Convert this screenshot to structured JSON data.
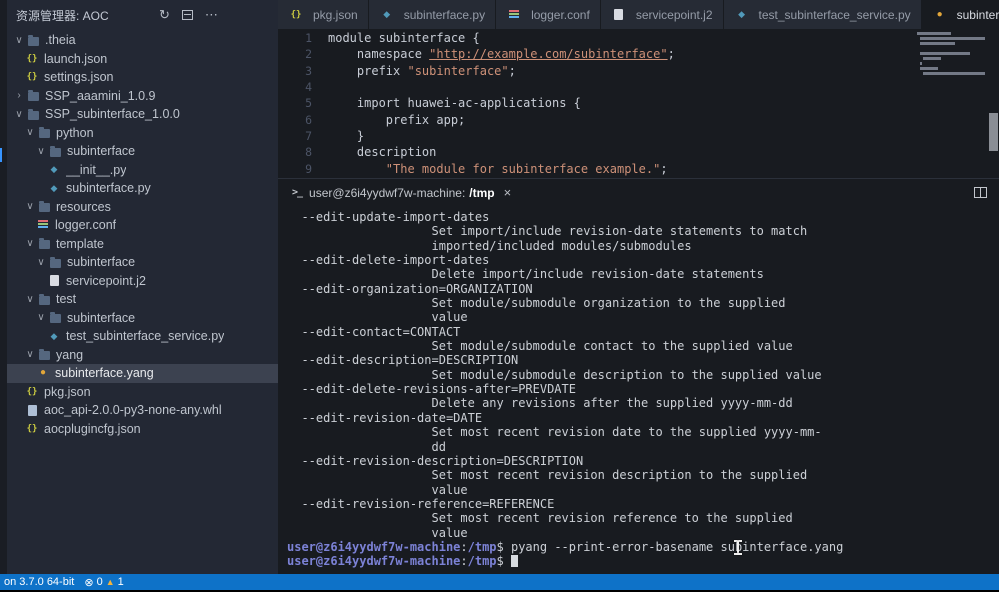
{
  "sidebar": {
    "title": "资源管理器: AOC",
    "items": [
      {
        "label": ".theia",
        "kind": "folder",
        "state": "open",
        "level": 0
      },
      {
        "label": "launch.json",
        "kind": "json",
        "level": 1
      },
      {
        "label": "settings.json",
        "kind": "json",
        "level": 1
      },
      {
        "label": "SSP_aaamini_1.0.9",
        "kind": "folder",
        "state": "closed",
        "level": 0
      },
      {
        "label": "SSP_subinterface_1.0.0",
        "kind": "folder",
        "state": "open",
        "level": 0
      },
      {
        "label": "python",
        "kind": "folder",
        "state": "open",
        "level": 1
      },
      {
        "label": "subinterface",
        "kind": "folder",
        "state": "open",
        "level": 2
      },
      {
        "label": "__init__.py",
        "kind": "python",
        "level": 3
      },
      {
        "label": "subinterface.py",
        "kind": "python",
        "level": 3
      },
      {
        "label": "resources",
        "kind": "folder",
        "state": "open",
        "level": 1
      },
      {
        "label": "logger.conf",
        "kind": "conf",
        "level": 2
      },
      {
        "label": "template",
        "kind": "folder",
        "state": "open",
        "level": 1
      },
      {
        "label": "subinterface",
        "kind": "folder",
        "state": "open",
        "level": 2
      },
      {
        "label": "servicepoint.j2",
        "kind": "jinja",
        "level": 3
      },
      {
        "label": "test",
        "kind": "folder",
        "state": "open",
        "level": 1
      },
      {
        "label": "subinterface",
        "kind": "folder",
        "state": "open",
        "level": 2
      },
      {
        "label": "test_subinterface_service.py",
        "kind": "python",
        "level": 3
      },
      {
        "label": "yang",
        "kind": "folder",
        "state": "open",
        "level": 1
      },
      {
        "label": "subinterface.yang",
        "kind": "yang",
        "level": 2,
        "selected": true
      },
      {
        "label": "pkg.json",
        "kind": "json",
        "level": 1
      },
      {
        "label": "aoc_api-2.0.0-py3-none-any.whl",
        "kind": "whl",
        "level": 1
      },
      {
        "label": "aocplugincfg.json",
        "kind": "json",
        "level": 1
      }
    ]
  },
  "tabs": [
    {
      "label": "pkg.json",
      "kind": "json",
      "active": false
    },
    {
      "label": "subinterface.py",
      "kind": "python",
      "active": false
    },
    {
      "label": "logger.conf",
      "kind": "conf",
      "active": false
    },
    {
      "label": "servicepoint.j2",
      "kind": "jinja",
      "active": false
    },
    {
      "label": "test_subinterface_service.py",
      "kind": "python",
      "active": false
    },
    {
      "label": "subinterface.yang",
      "kind": "yang",
      "active": true
    }
  ],
  "editor": {
    "lines": [
      {
        "n": "1",
        "segs": [
          {
            "t": "module subinterface {",
            "c": "p"
          }
        ]
      },
      {
        "n": "2",
        "segs": [
          {
            "t": "    namespace ",
            "c": "p"
          },
          {
            "t": "\"http://example.com/subinterface\"",
            "c": "u"
          },
          {
            "t": ";",
            "c": "p"
          }
        ]
      },
      {
        "n": "3",
        "segs": [
          {
            "t": "    prefix ",
            "c": "p"
          },
          {
            "t": "\"subinterface\"",
            "c": "s"
          },
          {
            "t": ";",
            "c": "p"
          }
        ]
      },
      {
        "n": "4",
        "segs": []
      },
      {
        "n": "5",
        "segs": [
          {
            "t": "    import huawei-ac-applications {",
            "c": "p"
          }
        ]
      },
      {
        "n": "6",
        "segs": [
          {
            "t": "        prefix app;",
            "c": "p"
          }
        ]
      },
      {
        "n": "7",
        "segs": [
          {
            "t": "    }",
            "c": "p"
          }
        ]
      },
      {
        "n": "8",
        "segs": [
          {
            "t": "    description",
            "c": "p"
          }
        ]
      },
      {
        "n": "9",
        "segs": [
          {
            "t": "        ",
            "c": "p"
          },
          {
            "t": "\"The module for subinterface example.\"",
            "c": "s"
          },
          {
            "t": ";",
            "c": "p"
          }
        ]
      }
    ]
  },
  "terminal": {
    "tab": {
      "host": "user@z6i4yydwf7w-machine:",
      "path": "/tmp"
    },
    "prompt": {
      "user": "user@z6i4yydwf7w-machine",
      "colon": ":",
      "path": "/tmp",
      "dollar": "$"
    },
    "lines": [
      "  --edit-update-import-dates",
      "                    Set import/include revision-date statements to match",
      "                    imported/included modules/submodules",
      "  --edit-delete-import-dates",
      "                    Delete import/include revision-date statements",
      "  --edit-organization=ORGANIZATION",
      "                    Set module/submodule organization to the supplied",
      "                    value",
      "  --edit-contact=CONTACT",
      "                    Set module/submodule contact to the supplied value",
      "  --edit-description=DESCRIPTION",
      "                    Set module/submodule description to the supplied value",
      "  --edit-delete-revisions-after=PREVDATE",
      "                    Delete any revisions after the supplied yyyy-mm-dd",
      "  --edit-revision-date=DATE",
      "                    Set most recent revision date to the supplied yyyy-mm-",
      "                    dd",
      "  --edit-revision-description=DESCRIPTION",
      "                    Set most recent revision description to the supplied",
      "                    value",
      "  --edit-revision-reference=REFERENCE",
      "                    Set most recent revision reference to the supplied",
      "                    value"
    ],
    "prompt_lines": [
      {
        "command": "pyang --print-error-basename subinterface.yang",
        "cursor": false
      },
      {
        "command": "",
        "cursor": true
      }
    ]
  },
  "status_bar": {
    "left": "on 3.7.0 64-bit",
    "errors": "0",
    "warnings": "1"
  },
  "glyphs": {
    "refresh": "↻",
    "more": "⋯",
    "close": "×",
    "chevron_open": "∨",
    "chevron_closed": "›",
    "terminal": ">_",
    "error": "⊗",
    "warning": "▲",
    "json": "{}",
    "python": "◆",
    "yang": "●"
  },
  "colors": {
    "accent": "#0e72c8",
    "selection": "#3c4250",
    "string": "#ce9178",
    "prompt": "#7c82d6",
    "yang_icon": "#e2a63a",
    "warning_icon": "#f3b43c"
  }
}
